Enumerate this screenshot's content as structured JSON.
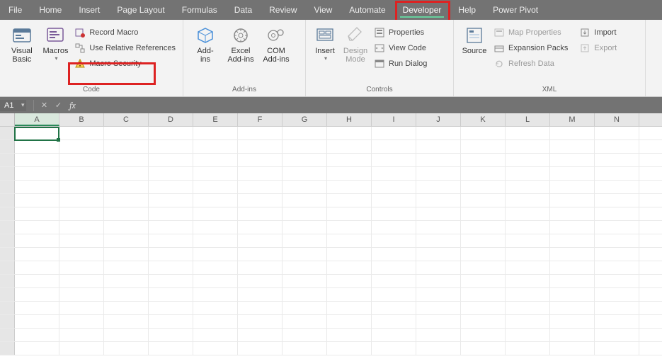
{
  "tabs": {
    "file": "File",
    "home": "Home",
    "insert": "Insert",
    "pagelayout": "Page Layout",
    "formulas": "Formulas",
    "data": "Data",
    "review": "Review",
    "view": "View",
    "automate": "Automate",
    "developer": "Developer",
    "help": "Help",
    "powerpivot": "Power Pivot"
  },
  "ribbon": {
    "code": {
      "visual_basic": "Visual\nBasic",
      "macros": "Macros",
      "record_macro": "Record Macro",
      "use_relative": "Use Relative References",
      "macro_security": "Macro Security",
      "group": "Code"
    },
    "addins": {
      "addins": "Add-\nins",
      "excel_addins": "Excel\nAdd-ins",
      "com_addins": "COM\nAdd-ins",
      "group": "Add-ins"
    },
    "controls": {
      "insert": "Insert",
      "design_mode": "Design\nMode",
      "properties": "Properties",
      "view_code": "View Code",
      "run_dialog": "Run Dialog",
      "group": "Controls"
    },
    "source": {
      "source": "Source",
      "group": "XML"
    },
    "xml": {
      "map_properties": "Map Properties",
      "expansion_packs": "Expansion Packs",
      "refresh_data": "Refresh Data",
      "import": "Import",
      "export": "Export"
    }
  },
  "namebox": "A1",
  "columns": [
    "A",
    "B",
    "C",
    "D",
    "E",
    "F",
    "G",
    "H",
    "I",
    "J",
    "K",
    "L",
    "M",
    "N"
  ],
  "active_cell": "A1"
}
